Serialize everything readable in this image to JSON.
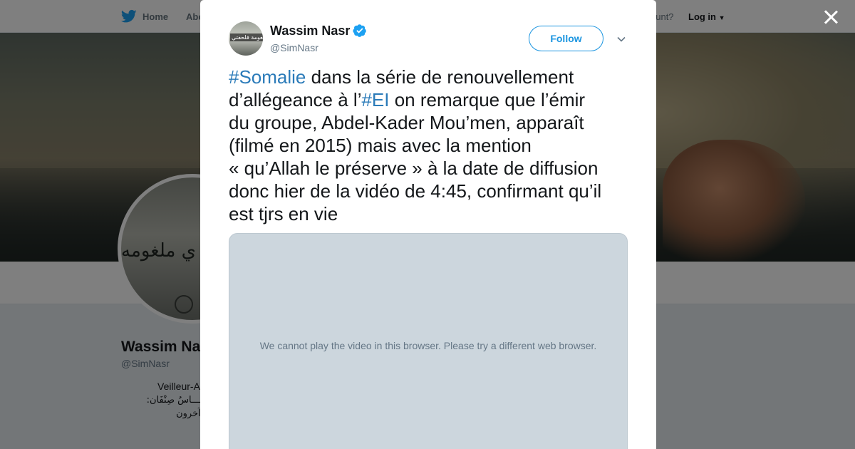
{
  "background": {
    "nav": {
      "home_label": "Home",
      "about_label": "Abo",
      "account_text": "ccount?",
      "login_label": "Log in"
    },
    "profile": {
      "avatar_text": "ي ملغومه",
      "name": "Wassim Na",
      "handle": "@SimNasr",
      "bio_line": "Veilleur-A",
      "bio_arabic": [
        "ـــــاسُ صِنْفَان:",
        "وآخرون",
        "ـأ"
      ]
    }
  },
  "modal": {
    "author": {
      "name": "Wassim Nasr",
      "handle": "@SimNasr",
      "verified": true,
      "avatar_text": "ملغومة فلحفتي"
    },
    "follow_label": "Follow",
    "tweet": {
      "hashtag1": "#Somalie",
      "line1_rest": " dans la série de renouvellement",
      "line2_pre": "d’allégeance à l’",
      "hashtag2": "#EI",
      "line2_post": " on remarque que l’émir",
      "line3": "du groupe, Abdel-Kader Mou’men, apparaît",
      "line4": "(filmé en 2015) mais avec la mention",
      "line5": "« qu’Allah le préserve » à la date de diffusion",
      "line6": "donc hier de la vidéo de 4:45, confirmant qu’il",
      "line7": "est tjrs en vie"
    },
    "video_message": "We cannot play the video in this browser. Please try a different web browser."
  },
  "colors": {
    "twitter_blue": "#1da1f2",
    "link_blue": "#2b7bb9",
    "follow_blue": "#1b95e0",
    "video_placeholder": "#ccd6dd"
  },
  "icons": {
    "nav": "twitter-bird-icon",
    "verified": "verified-badge-icon",
    "caret": "chevron-down-icon",
    "close": "close-icon"
  }
}
